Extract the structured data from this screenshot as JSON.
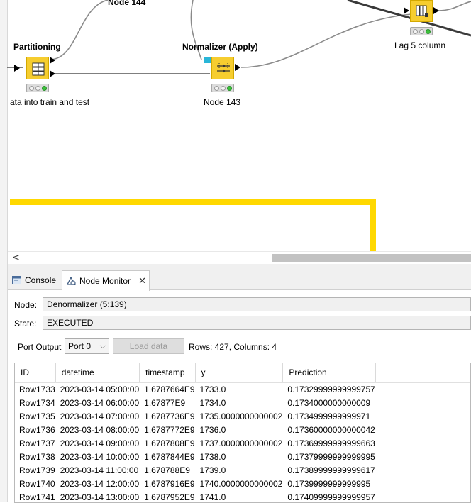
{
  "workflow": {
    "nodes": [
      {
        "id": "partitioning",
        "title": "Partitioning",
        "caption": "ata into train and test"
      },
      {
        "id": "normalizer",
        "title": "Normalizer (Apply)",
        "caption": "Node 143"
      },
      {
        "id": "lag",
        "title": "",
        "caption": "Lag 5 column"
      }
    ],
    "top_caption": "Node 144",
    "colors": {
      "node": "#f6cd2f",
      "annotation": "#ffd800",
      "edge": "#7a7a7a",
      "dark_edge": "#333333"
    }
  },
  "tabs": [
    {
      "label": "Console",
      "icon": "console-icon"
    },
    {
      "label": "Node Monitor",
      "icon": "node-monitor-icon",
      "close": "✕"
    }
  ],
  "scroll": {
    "left_arrow": "<"
  },
  "monitor": {
    "node_label": "Node:",
    "node_value": "Denormalizer  (5:139)",
    "state_label": "State:",
    "state_value": "EXECUTED",
    "port_output_label": "Port Output",
    "port_select": "Port 0",
    "load_button": "Load data",
    "rows_info": "Rows: 427, Columns: 4"
  },
  "table": {
    "columns": [
      "ID",
      "datetime",
      "timestamp",
      "y",
      "Prediction"
    ],
    "rows": [
      [
        "Row1733",
        "2023-03-14 05:00:00",
        "1.6787664E9",
        "1733.0",
        "0.17329999999999757"
      ],
      [
        "Row1734",
        "2023-03-14 06:00:00",
        "1.67877E9",
        "1734.0",
        "0.1734000000000009"
      ],
      [
        "Row1735",
        "2023-03-14 07:00:00",
        "1.6787736E9",
        "1735.0000000000002",
        "0.1734999999999971"
      ],
      [
        "Row1736",
        "2023-03-14 08:00:00",
        "1.6787772E9",
        "1736.0",
        "0.17360000000000042"
      ],
      [
        "Row1737",
        "2023-03-14 09:00:00",
        "1.6787808E9",
        "1737.0000000000002",
        "0.17369999999999663"
      ],
      [
        "Row1738",
        "2023-03-14 10:00:00",
        "1.6787844E9",
        "1738.0",
        "0.17379999999999995"
      ],
      [
        "Row1739",
        "2023-03-14 11:00:00",
        "1.678788E9",
        "1739.0",
        "0.17389999999999617"
      ],
      [
        "Row1740",
        "2023-03-14 12:00:00",
        "1.6787916E9",
        "1740.0000000000002",
        "0.1739999999999995"
      ],
      [
        "Row1741",
        "2023-03-14 13:00:00",
        "1.6787952E9",
        "1741.0",
        "0.17409999999999957"
      ]
    ]
  }
}
